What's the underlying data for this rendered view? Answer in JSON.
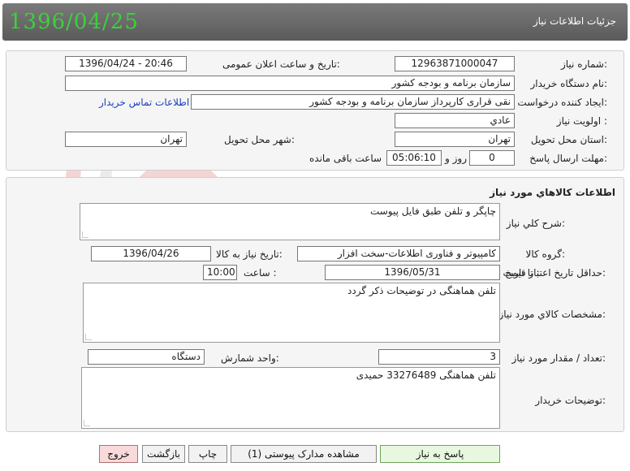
{
  "header": {
    "title": "جزئیات اطلاعات نیاز",
    "date": "1396/04/25"
  },
  "info": {
    "need_number_label": "شماره نیاز:",
    "need_number": "1296387100004​7",
    "announce_label": "تاریخ و ساعت اعلان عمومی:",
    "announce_value": "1396/04/24 - 20:46",
    "buyer_org_label": "نام دستگاه خریدار:",
    "buyer_org": "سازمان برنامه و بودجه کشور",
    "creator_label": "ایجاد کننده درخواست:",
    "creator": "نقی قراری کارپرداز سازمان برنامه و بودجه کشور",
    "contact_link": "اطلاعات تماس خریدار",
    "priority_label": "اولویت نیاز :",
    "priority": "عادي",
    "province_label": "استان محل تحویل:",
    "province": "تهران",
    "city_label": "شهر محل تحویل:",
    "city": "تهران",
    "deadline_label": "مهلت ارسال پاسخ:",
    "days": "0",
    "days_suffix": "روز و",
    "time_left": "05:06:10",
    "time_suffix": "ساعت باقی مانده"
  },
  "goods": {
    "section_title": "اطلاعات کالاهاي مورد نیاز",
    "summary_label": "شرح کلي نیاز:",
    "summary": "چاپگر و تلفن طبق فایل پیوست",
    "group_label": "گروه کالا:",
    "group": "کامپیوتر و فناوری اطلاعات-سخت افزار",
    "need_date_label": "تاریخ نیاز به کالا:",
    "need_date": "1396/04/26",
    "validity_label": "حداقل تاریخ اعتبار قیمت:",
    "until_label": "تا تاریخ :",
    "validity_date": "1396/05/31",
    "hour_label": "ساعت :",
    "validity_time": "10:00",
    "specs_label": "مشخصات کالاي مورد نیاز:",
    "specs": "تلفن هماهنگی در توضیحات ذکر گردد",
    "qty_label": "تعداد / مقدار مورد نیاز:",
    "qty": "3",
    "unit_label": "واحد شمارش:",
    "unit": "دستگاه",
    "buyer_notes_label": "توضیحات خریدار:",
    "buyer_notes": "تلفن هماهنگی 33276489 حمیدی"
  },
  "buttons": {
    "reply": "پاسخ به نیاز",
    "attachments": "مشاهده مدارک پیوستی (1)",
    "print": "چاپ",
    "back": "بازگشت",
    "exit": "خروج"
  },
  "colors": {
    "date_green": "#3bd13b",
    "header_gray": "#6a6a6a",
    "link_blue": "#1a3fc0"
  }
}
